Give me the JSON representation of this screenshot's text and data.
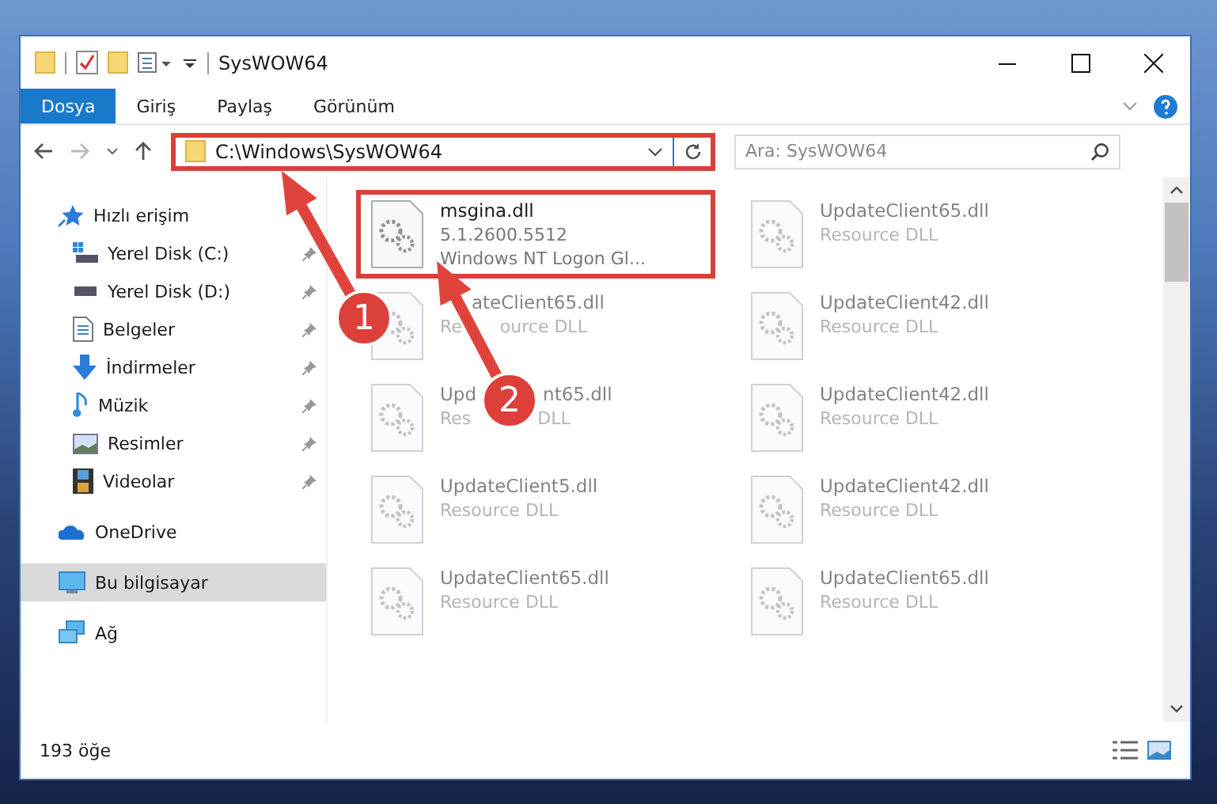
{
  "window": {
    "title": "SysWOW64"
  },
  "ribbon_tabs": [
    {
      "label": "Dosya",
      "selected": true
    },
    {
      "label": "Giriş",
      "selected": false
    },
    {
      "label": "Paylaş",
      "selected": false
    },
    {
      "label": "Görünüm",
      "selected": false
    }
  ],
  "address": {
    "path": "C:\\Windows\\SysWOW64",
    "highlighted": true
  },
  "search": {
    "placeholder": "Ara: SysWOW64"
  },
  "sidebar": {
    "items": [
      {
        "label": "Hızlı erişim",
        "selected": false,
        "children": [
          {
            "label": "Yerel Disk (C:)",
            "selected": false,
            "pinned": true
          },
          {
            "label": "Yerel Disk (D:)",
            "selected": false,
            "pinned": true
          },
          {
            "label": "Belgeler",
            "selected": false,
            "pinned": true
          },
          {
            "label": "İndirmeler",
            "selected": false,
            "pinned": true
          },
          {
            "label": "Müzik",
            "selected": false,
            "pinned": true
          },
          {
            "label": "Resimler",
            "selected": false,
            "pinned": true
          },
          {
            "label": "Videolar",
            "selected": false,
            "pinned": true
          }
        ]
      },
      {
        "label": "OneDrive",
        "selected": false
      },
      {
        "label": "Bu bilgisayar",
        "selected": true
      },
      {
        "label": "Ağ",
        "selected": false
      }
    ]
  },
  "files": [
    {
      "name": "msgina.dll",
      "lines": [
        "5.1.2600.5512",
        "Windows NT Logon Gl..."
      ],
      "highlighted": true,
      "faded": false
    },
    {
      "name": "UpdateClient65.dll",
      "lines": [
        "Resource DLL"
      ],
      "highlighted": false,
      "faded": true
    },
    {
      "name": [
        "ateClient65.dll"
      ],
      "lines": [
        [
          "Re",
          "ource DLL"
        ]
      ],
      "highlighted": false,
      "faded": true
    },
    {
      "name": "UpdateClient42.dll",
      "lines": [
        "Resource DLL"
      ],
      "highlighted": false,
      "faded": true
    },
    {
      "name": [
        "Upd",
        "nt65.dll"
      ],
      "lines": [
        [
          "Res",
          "DLL"
        ]
      ],
      "highlighted": false,
      "faded": true
    },
    {
      "name": "UpdateClient42.dll",
      "lines": [
        "Resource DLL"
      ],
      "highlighted": false,
      "faded": true
    },
    {
      "name": "UpdateClient5.dll",
      "lines": [
        "Resource DLL"
      ],
      "highlighted": false,
      "faded": true
    },
    {
      "name": "UpdateClient42.dll",
      "lines": [
        "Resource DLL"
      ],
      "highlighted": false,
      "faded": true
    },
    {
      "name": "UpdateClient65.dll",
      "lines": [
        "Resource DLL"
      ],
      "highlighted": false,
      "faded": true
    },
    {
      "name": "UpdateClient65.dll",
      "lines": [
        "Resource DLL"
      ],
      "highlighted": false,
      "faded": true
    }
  ],
  "status_bar": {
    "count": "193 öğe"
  },
  "annotations": [
    {
      "label": "1"
    },
    {
      "label": "2"
    }
  ]
}
